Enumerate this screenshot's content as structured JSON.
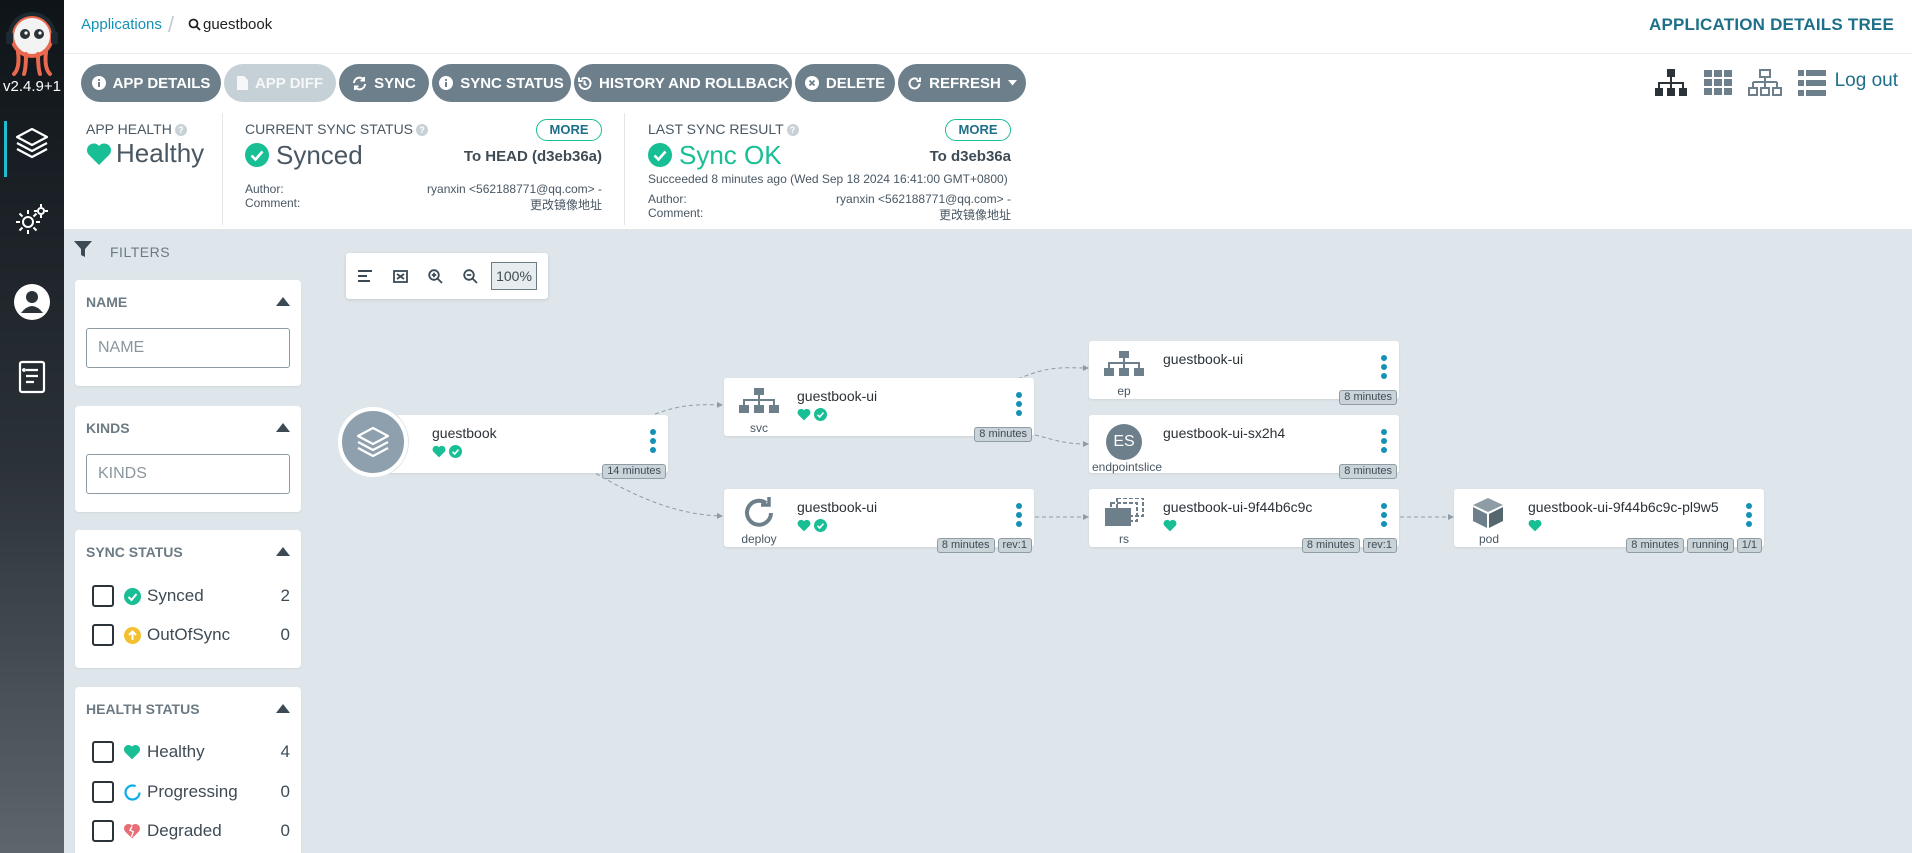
{
  "app": {
    "version": "v2.4.9+1"
  },
  "breadcrumb": {
    "parent": "Applications",
    "current": "guestbook"
  },
  "header": {
    "title": "APPLICATION DETAILS TREE",
    "logout": "Log out"
  },
  "toolbar": {
    "app_details": "APP DETAILS",
    "app_diff": "APP DIFF",
    "sync": "SYNC",
    "sync_status": "SYNC STATUS",
    "history": "HISTORY AND ROLLBACK",
    "delete": "DELETE",
    "refresh": "REFRESH"
  },
  "status": {
    "health_label": "APP HEALTH",
    "health_value": "Healthy",
    "sync_label": "CURRENT SYNC STATUS",
    "sync_value": "Synced",
    "sync_target": "To HEAD (d3eb36a)",
    "sync_more": "MORE",
    "author_label": "Author:",
    "comment_label": "Comment:",
    "sync_author": "ryanxin <562188771@qq.com> -",
    "sync_comment": "更改镜像地址",
    "last_label": "LAST SYNC RESULT",
    "last_value": "Sync OK",
    "last_target": "To d3eb36a",
    "last_more": "MORE",
    "last_when": "Succeeded 8 minutes ago (Wed Sep 18 2024 16:41:00 GMT+0800)",
    "last_author": "ryanxin <562188771@qq.com> -",
    "last_comment": "更改镜像地址"
  },
  "filters": {
    "title": "FILTERS",
    "name": {
      "title": "NAME",
      "placeholder": "NAME"
    },
    "kinds": {
      "title": "KINDS",
      "placeholder": "KINDS"
    },
    "sync_status": {
      "title": "SYNC STATUS",
      "items": [
        {
          "label": "Synced",
          "count": "2"
        },
        {
          "label": "OutOfSync",
          "count": "0"
        }
      ]
    },
    "health_status": {
      "title": "HEALTH STATUS",
      "items": [
        {
          "label": "Healthy",
          "count": "4"
        },
        {
          "label": "Progressing",
          "count": "0"
        },
        {
          "label": "Degraded",
          "count": "0"
        }
      ]
    }
  },
  "zoom": {
    "level": "100%"
  },
  "graph": {
    "root": {
      "name": "guestbook",
      "age": "14 minutes"
    },
    "svc": {
      "name": "guestbook-ui",
      "kind": "svc",
      "age": "8 minutes"
    },
    "deploy": {
      "name": "guestbook-ui",
      "kind": "deploy",
      "age": "8 minutes",
      "rev": "rev:1"
    },
    "ep": {
      "name": "guestbook-ui",
      "kind": "ep",
      "age": "8 minutes"
    },
    "endpointslice": {
      "name": "guestbook-ui-sx2h4",
      "kind": "endpointslice",
      "badge": "ES",
      "age": "8 minutes"
    },
    "rs": {
      "name": "guestbook-ui-9f44b6c9c",
      "kind": "rs",
      "age": "8 minutes",
      "rev": "rev:1"
    },
    "pod": {
      "name": "guestbook-ui-9f44b6c9c-pl9w5",
      "kind": "pod",
      "age": "8 minutes",
      "phase": "running",
      "ready": "1/1"
    }
  },
  "colors": {
    "healthy": "#18be94",
    "accent": "#1491b5",
    "outofsync": "#f4c030",
    "degraded": "#e96d76"
  }
}
